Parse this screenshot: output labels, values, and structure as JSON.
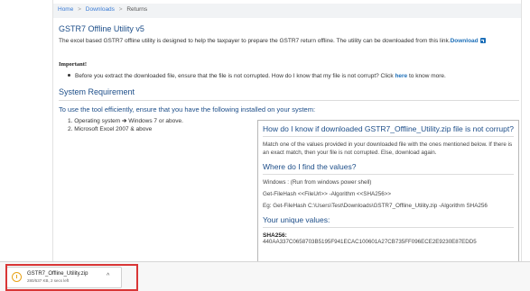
{
  "breadcrumb": {
    "items": [
      "Home",
      "Downloads",
      "Returns"
    ]
  },
  "page": {
    "title": "GSTR7 Offline Utility v5",
    "intro_text": "The excel based GSTR7 offline utility is designed to help the taxpayer to prepare the GSTR7 return offline. The utility can be downloaded from this link.",
    "download_link": "Download",
    "important_label": "Important!",
    "bullet_text": "Before you extract the downloaded file, ensure that the file is not corrupted. How do I know that my file is not corrupt? Click",
    "here_link": "here",
    "bullet_tail": "to know more.",
    "system_requirement_heading": "System Requirement",
    "instruction": "To use the tool efficiently, ensure that you have the following installed on your system:",
    "requirements": [
      {
        "prefix": "1. Operating system ",
        "arrow": "➔",
        "suffix": " Windows 7 or above."
      },
      {
        "prefix": "2. Microsoft Excel 2007 & above",
        "arrow": "",
        "suffix": ""
      }
    ]
  },
  "info_box": {
    "title": "How do I know if downloaded GSTR7_Offline_Utility.zip file is not corrupt?",
    "match_text": "Match one of the values provided in your downloaded file with the ones mentioned below. If there is an exact match, then your file is not corrupted. Else, download again.",
    "find_heading": "Where do I find the values?",
    "windows_line": "Windows : (Run from windows power shell)",
    "command_line": "Get-FileHash <<FileUrl>> -Algorithm <<SHA256>>",
    "example_line": "Eg: Get-FileHash C:\\Users\\Test\\Downloads\\GSTR7_Offline_Utility.zip -Algorithm SHA256",
    "unique_heading": "Your unique values:",
    "sha_label": "SHA256:",
    "sha_value": "440AA337C0658703B5195F941ECAC100601A27CB735FF096ECE2E9230E87EDD5"
  },
  "download_bar": {
    "file_name": "GSTR7_Offline_Utility.zip",
    "file_status": "280/537 KB, 2 secs left",
    "icon": "download-progress-icon",
    "chevron": "^"
  }
}
